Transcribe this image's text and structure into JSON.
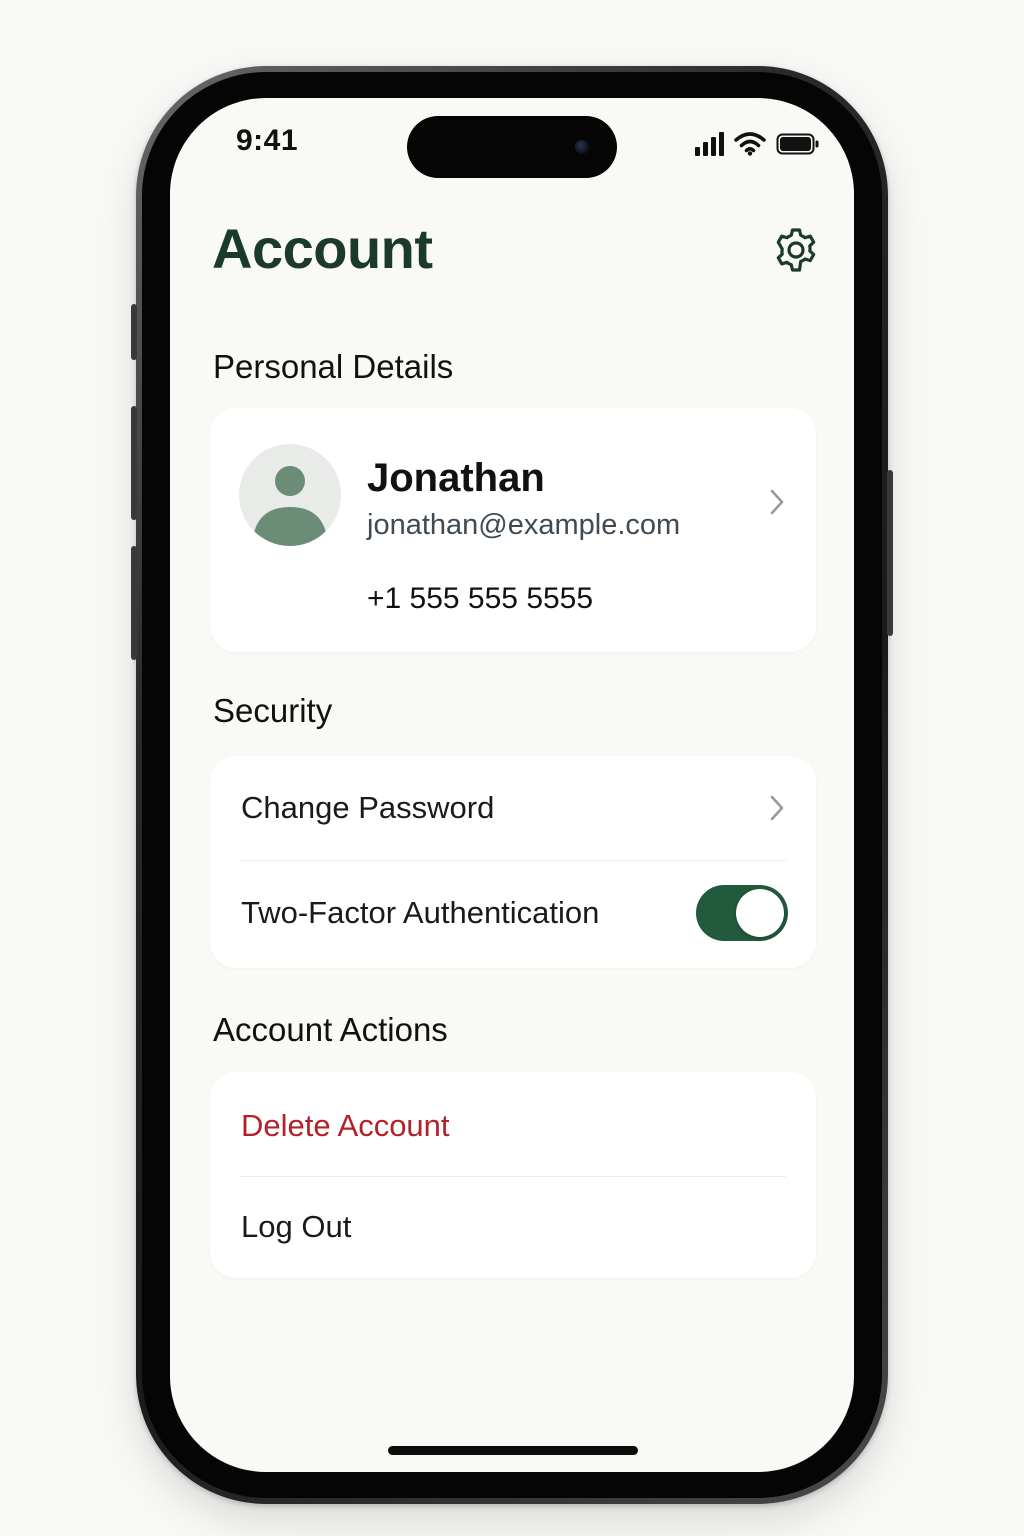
{
  "status_bar": {
    "time": "9:41"
  },
  "header": {
    "title": "Account",
    "settings_icon": "gear-icon"
  },
  "personal_details": {
    "section_label": "Personal Details",
    "name": "Jonathan",
    "email": "jonathan@example.com",
    "phone": "+1 555 555 5555",
    "avatar_icon": "user-avatar-icon"
  },
  "security": {
    "section_label": "Security",
    "change_password_label": "Change Password",
    "two_factor_label": "Two-Factor Authentication",
    "two_factor_enabled": true
  },
  "account_actions": {
    "section_label": "Account Actions",
    "delete_label": "Delete Account",
    "logout_label": "Log Out"
  },
  "colors": {
    "accent": "#215a3c",
    "title": "#1c3a2a",
    "danger": "#b3222a",
    "avatar": "#6b8c77"
  }
}
